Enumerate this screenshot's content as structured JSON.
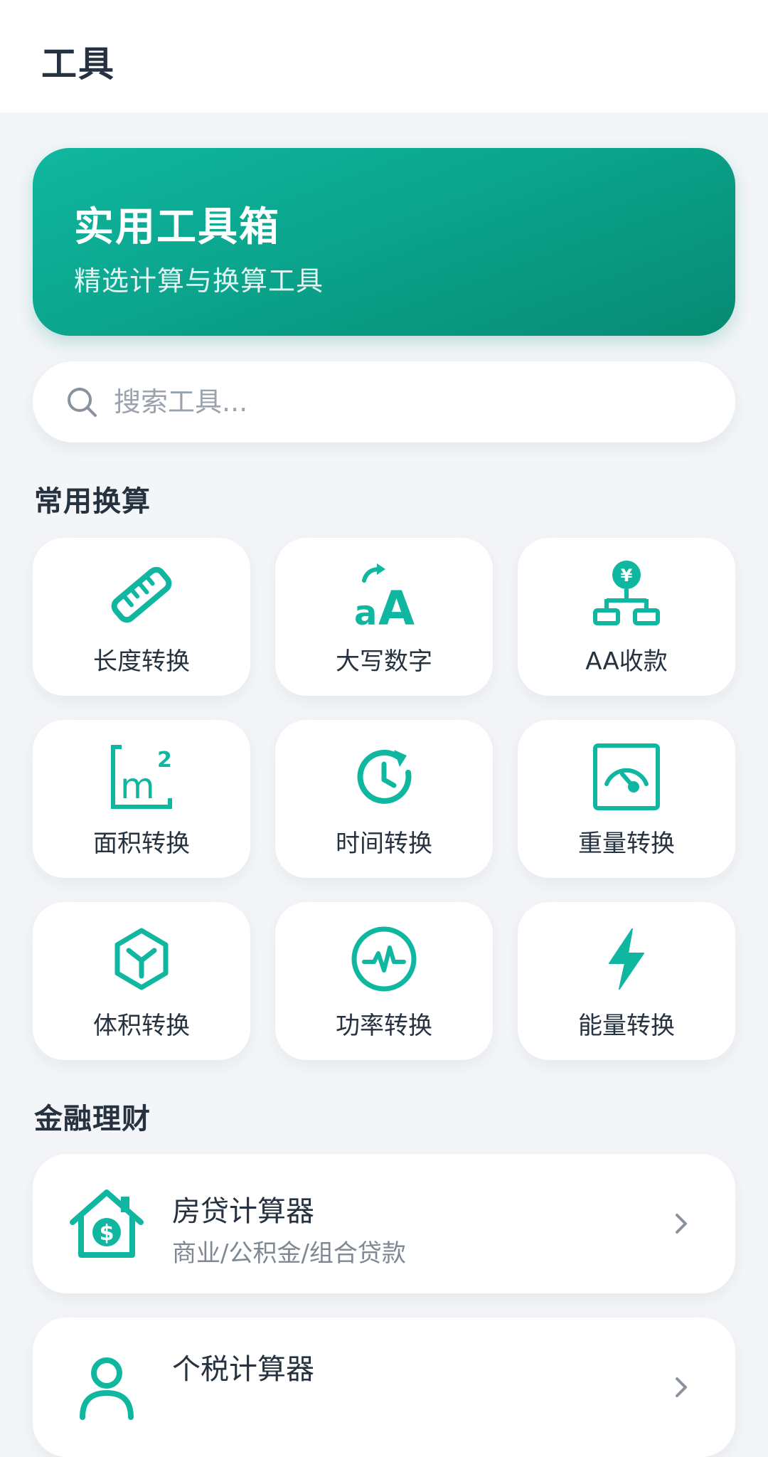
{
  "header": {
    "title": "工具"
  },
  "hero": {
    "title": "实用工具箱",
    "subtitle": "精选计算与换算工具"
  },
  "search": {
    "placeholder": "搜索工具...",
    "value": ""
  },
  "sections": {
    "common": {
      "title": "常用换算",
      "tools": [
        {
          "label": "长度转换",
          "icon": "ruler-icon"
        },
        {
          "label": "大写数字",
          "icon": "text-case-icon"
        },
        {
          "label": "AA收款",
          "icon": "split-payment-icon"
        },
        {
          "label": "面积转换",
          "icon": "square-meter-icon"
        },
        {
          "label": "时间转换",
          "icon": "clock-refresh-icon"
        },
        {
          "label": "重量转换",
          "icon": "scale-gauge-icon"
        },
        {
          "label": "体积转换",
          "icon": "cube-icon"
        },
        {
          "label": "功率转换",
          "icon": "pulse-icon"
        },
        {
          "label": "能量转换",
          "icon": "lightning-icon"
        }
      ]
    },
    "finance": {
      "title": "金融理财",
      "items": [
        {
          "title": "房贷计算器",
          "subtitle": "商业/公积金/组合贷款",
          "icon": "house-dollar-icon"
        },
        {
          "title": "个税计算器",
          "subtitle": "",
          "icon": "person-tax-icon"
        }
      ]
    }
  },
  "colors": {
    "accent": "#10b7a0",
    "accent_dark": "#078a72",
    "background": "#f3f5f8",
    "text": "#26323f",
    "muted": "#7f8893"
  }
}
